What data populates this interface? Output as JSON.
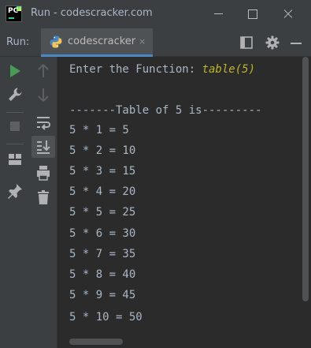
{
  "window": {
    "title": "Run - codescracker.com"
  },
  "run_panel": {
    "label": "Run:",
    "tab_label": "codescracker",
    "tab_close": "×"
  },
  "console": {
    "prompt": "Enter the Function: ",
    "input": "table(5)",
    "heading": "-------Table of 5 is---------",
    "lines": [
      "5 * 1 = 5",
      "5 * 2 = 10",
      "5 * 3 = 15",
      "5 * 4 = 20",
      "5 * 5 = 25",
      "5 * 6 = 30",
      "5 * 7 = 35",
      "5 * 8 = 40",
      "5 * 9 = 45",
      "5 * 10 = 50"
    ]
  },
  "colors": {
    "background": "#2b2b2b",
    "panel": "#3c3f41",
    "text": "#a9b7c6",
    "user_input": "#bbb529",
    "run_green": "#499c54",
    "accent_blue": "#4a88c7"
  },
  "icons": {
    "title": "pycharm-logo-icon",
    "window_controls": [
      "minimize-icon",
      "maximize-icon",
      "close-icon"
    ],
    "tab": "python-icon",
    "header": [
      "layout-icon",
      "gear-icon",
      "hide-icon"
    ],
    "toolbar_left": [
      "rerun-icon",
      "wrench-icon",
      "stop-icon",
      "restore-layout-icon",
      "pin-icon"
    ],
    "toolbar_right": [
      "up-arrow-icon",
      "down-arrow-icon",
      "soft-wrap-icon",
      "scroll-to-end-icon",
      "print-icon",
      "trash-icon"
    ]
  }
}
